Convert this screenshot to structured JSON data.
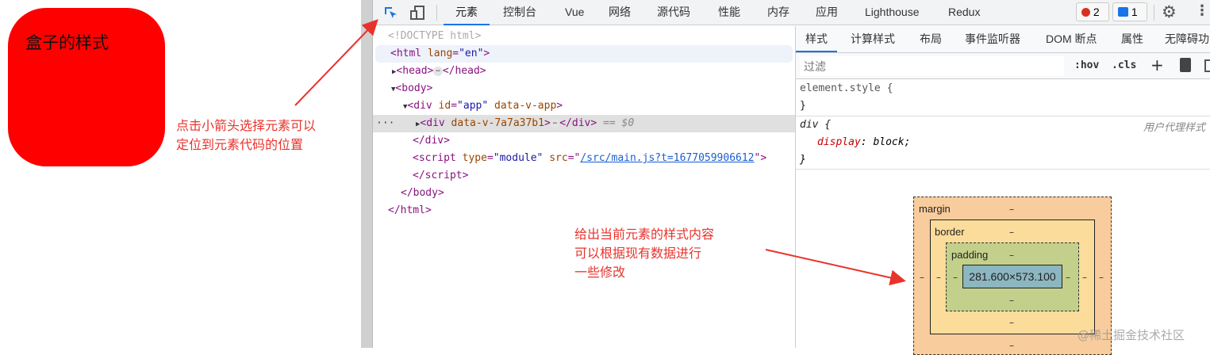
{
  "page": {
    "box_text": "盒子的样式",
    "box_color": "#ff0000"
  },
  "toolbar": {
    "tabs": [
      "元素",
      "控制台",
      "Vue",
      "网络",
      "源代码",
      "性能",
      "内存",
      "应用",
      "Lighthouse",
      "Redux"
    ],
    "errors": "2",
    "messages": "1",
    "icons": [
      "inspect-element-icon",
      "device-toggle-icon",
      "settings-icon",
      "more-icon"
    ]
  },
  "dom": {
    "doctype": "<!DOCTYPE html>",
    "html_open": "<html",
    "html_lang_attr": " lang",
    "html_lang_val": "\"en\"",
    "gt": ">",
    "head_open": "<head>",
    "head_close": "</head>",
    "ellipsis": "⋯",
    "body_open": "<body>",
    "div_app_open": "<div",
    "div_app_id": " id",
    "div_app_id_val": "\"app\"",
    "div_app_attr": " data-v-app",
    "div_sel_open": "<div",
    "div_sel_attr": " data-v-7a7a37b1",
    "div_close": "</div>",
    "selected_marker": " == $0",
    "script_open": "<script",
    "script_type": " type",
    "script_type_val": "\"module\"",
    "script_src": " src",
    "script_src_val": "/src/main.js?t=1677059906612",
    "script_close": "</script>",
    "body_close": "</body>",
    "html_close": "</html>"
  },
  "styles": {
    "tabs": [
      "样式",
      "计算样式",
      "布局",
      "事件监听器",
      "DOM 断点",
      "属性",
      "无障碍功"
    ],
    "filter_placeholder": "过滤",
    "hov": ":hov",
    "cls": ".cls",
    "element_style": "element.style {",
    "close_brace": "}",
    "div_rule": "div {",
    "prop": "display",
    "val": "block;",
    "source": "用户代理样式"
  },
  "box_model": {
    "margin": "margin",
    "border": "border",
    "padding": "padding",
    "content": "281.600×573.100",
    "dash": "–"
  },
  "annotations": {
    "arrow_note": [
      "点击小箭头选择元素可以",
      "定位到元素代码的位置"
    ],
    "styles_note": [
      "给出当前元素的样式内容",
      "可以根据现有数据进行",
      "一些修改"
    ],
    "watermark": "@稀土掘金技术社区"
  }
}
